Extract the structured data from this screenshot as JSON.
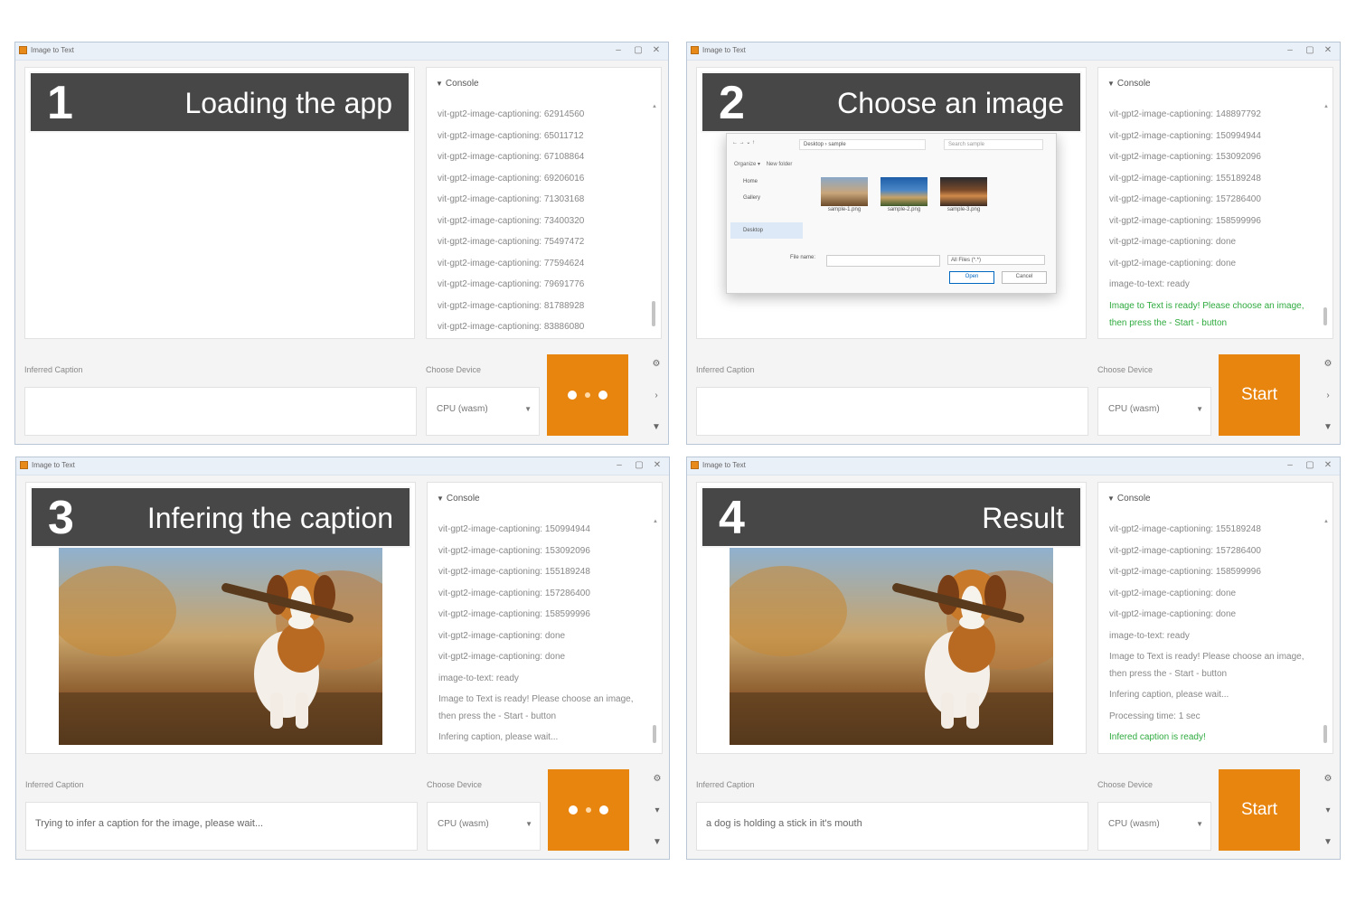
{
  "windows": [
    {
      "window_title": "Image to Text",
      "banner": {
        "number": "1",
        "title": "Loading the app"
      },
      "console": {
        "header": "Console",
        "lines": [
          {
            "text": "vit-gpt2-image-captioning: 62914560"
          },
          {
            "text": "vit-gpt2-image-captioning: 65011712"
          },
          {
            "text": "vit-gpt2-image-captioning: 67108864"
          },
          {
            "text": "vit-gpt2-image-captioning: 69206016"
          },
          {
            "text": "vit-gpt2-image-captioning: 71303168"
          },
          {
            "text": "vit-gpt2-image-captioning: 73400320"
          },
          {
            "text": "vit-gpt2-image-captioning: 75497472"
          },
          {
            "text": "vit-gpt2-image-captioning: 77594624"
          },
          {
            "text": "vit-gpt2-image-captioning: 79691776"
          },
          {
            "text": "vit-gpt2-image-captioning: 81788928"
          },
          {
            "text": "vit-gpt2-image-captioning: 83886080"
          }
        ]
      },
      "inferred_caption_label": "Inferred Caption",
      "caption_value": "",
      "device_label": "Choose Device",
      "device_value": "CPU (wasm)",
      "start_state": "loading",
      "start_label": ""
    },
    {
      "window_title": "Image to Text",
      "banner": {
        "number": "2",
        "title": "Choose an image"
      },
      "file_dialog": {
        "path": "Desktop  ›  sample",
        "search": "Search sample",
        "organize": "Organize ▾",
        "new_folder": "New folder",
        "nav": [
          "Home",
          "Gallery",
          "Desktop"
        ],
        "files": [
          "sample-1.png",
          "sample-2.png",
          "sample-3.png"
        ],
        "file_name_label": "File name:",
        "file_type": "All Files (*.*)",
        "open": "Open",
        "cancel": "Cancel"
      },
      "console": {
        "header": "Console",
        "lines": [
          {
            "text": "vit-gpt2-image-captioning: 148897792"
          },
          {
            "text": "vit-gpt2-image-captioning: 150994944"
          },
          {
            "text": "vit-gpt2-image-captioning: 153092096"
          },
          {
            "text": "vit-gpt2-image-captioning: 155189248"
          },
          {
            "text": "vit-gpt2-image-captioning: 157286400"
          },
          {
            "text": "vit-gpt2-image-captioning: 158599996"
          },
          {
            "text": "vit-gpt2-image-captioning: done"
          },
          {
            "text": "vit-gpt2-image-captioning: done"
          },
          {
            "text": "image-to-text: ready"
          },
          {
            "text": "Image to Text is ready! Please choose an image, then press the - Start - button",
            "green": true,
            "wrap": true
          }
        ]
      },
      "inferred_caption_label": "Inferred Caption",
      "caption_value": "",
      "device_label": "Choose Device",
      "device_value": "CPU (wasm)",
      "start_state": "ready",
      "start_label": "Start"
    },
    {
      "window_title": "Image to Text",
      "banner": {
        "number": "3",
        "title": "Infering the caption"
      },
      "console": {
        "header": "Console",
        "lines": [
          {
            "text": "vit-gpt2-image-captioning: 150994944"
          },
          {
            "text": "vit-gpt2-image-captioning: 153092096"
          },
          {
            "text": "vit-gpt2-image-captioning: 155189248"
          },
          {
            "text": "vit-gpt2-image-captioning: 157286400"
          },
          {
            "text": "vit-gpt2-image-captioning: 158599996"
          },
          {
            "text": "vit-gpt2-image-captioning: done"
          },
          {
            "text": "vit-gpt2-image-captioning: done"
          },
          {
            "text": "image-to-text: ready"
          },
          {
            "text": "Image to Text is ready! Please choose an image, then press the - Start - button",
            "wrap": true
          },
          {
            "text": "Infering caption, please wait..."
          }
        ]
      },
      "inferred_caption_label": "Inferred Caption",
      "caption_value": "Trying to infer a caption for the image, please wait...",
      "device_label": "Choose Device",
      "device_value": "CPU (wasm)",
      "start_state": "loading",
      "start_label": ""
    },
    {
      "window_title": "Image to Text",
      "banner": {
        "number": "4",
        "title": "Result"
      },
      "console": {
        "header": "Console",
        "lines": [
          {
            "text": "vit-gpt2-image-captioning: 155189248"
          },
          {
            "text": "vit-gpt2-image-captioning: 157286400"
          },
          {
            "text": "vit-gpt2-image-captioning: 158599996"
          },
          {
            "text": "vit-gpt2-image-captioning: done"
          },
          {
            "text": "vit-gpt2-image-captioning: done"
          },
          {
            "text": "image-to-text: ready"
          },
          {
            "text": "Image to Text is ready! Please choose an image, then press the - Start - button",
            "wrap": true
          },
          {
            "text": "Infering caption, please wait..."
          },
          {
            "text": "Processing time: 1 sec"
          },
          {
            "text": "Infered caption is ready!",
            "green": true
          }
        ]
      },
      "inferred_caption_label": "Inferred Caption",
      "caption_value": "a dog is holding a stick in it's mouth",
      "device_label": "Choose Device",
      "device_value": "CPU (wasm)",
      "start_state": "ready",
      "start_label": "Start"
    }
  ],
  "colors": {
    "accent": "#e8850f",
    "console_ok": "#2eaa3e",
    "banner": "#474747"
  }
}
